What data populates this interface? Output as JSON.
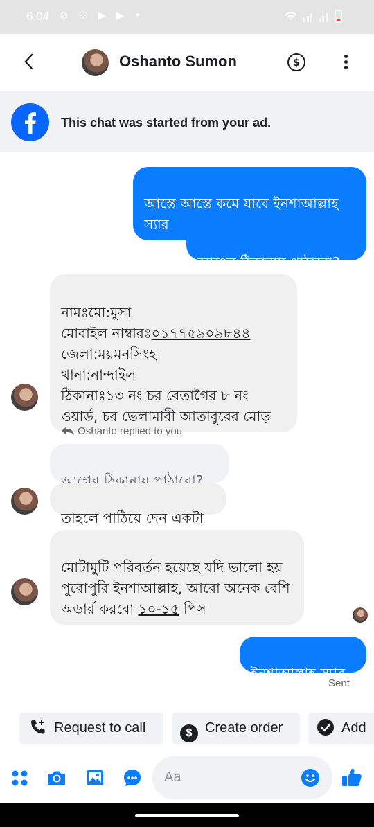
{
  "status_bar": {
    "time": "6:04"
  },
  "header": {
    "contact_name": "Oshanto Sumon",
    "dollar_symbol": "$"
  },
  "banner": {
    "text": "This chat was started from your ad."
  },
  "messages": {
    "m1": "আস্তে আস্তে কমে যাবে ইনশাআল্লাহ স্যার",
    "m2": "আগের ঠিকানায় পাঠাবো?",
    "m3_line1": "নামঃমো:মুসা",
    "m3_label2": "মোবাইল নাম্বারঃ",
    "m3_phone": "০১৭৭৫৯০৯৮৪৪",
    "m3_rest": "জেলা:ময়মনসিংহ\nথানা:নান্দাইল\nঠিকানাঃ১৩ নং চর বেতাগৈর ৮ নং ওয়ার্ড, চর ভেলামারী আতাবুরের মোড়",
    "reply_label": "Oshanto replied to you",
    "quoted": "আগের ঠিকানায় পাঠাবো?",
    "m4": "তাহলে পাঠিয়ে দেন একটা",
    "m5_text": "মোটামুটি পরিবর্তন হয়েছে যদি ভালো হয় পুরোপুরি ইনশাআল্লাহ, আরো অনেক বেশি অডার্র করবো ",
    "m5_qty": "১০-১৫",
    "m5_tail": " পিস",
    "m6": "ইনশাআল্লাহ স্যার",
    "sent_status": "Sent"
  },
  "actions": {
    "request_call": "Request to call",
    "create_order": "Create order",
    "add": "Add"
  },
  "composer": {
    "placeholder": "Aa"
  },
  "colors": {
    "accent": "#0a7cff",
    "facebook_blue": "#0866ff"
  }
}
